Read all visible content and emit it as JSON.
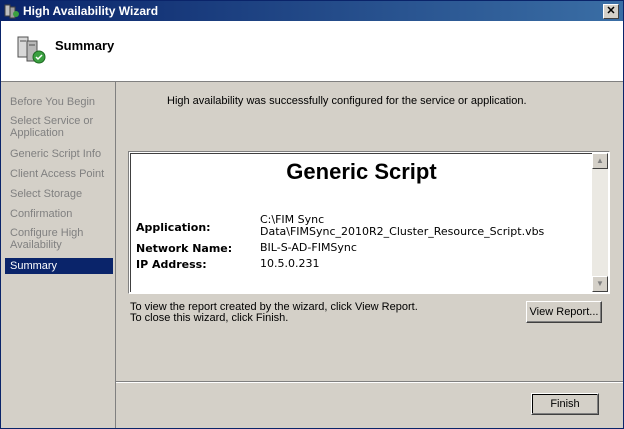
{
  "window": {
    "title": "High Availability Wizard",
    "close_glyph": "✕"
  },
  "header": {
    "title": "Summary"
  },
  "sidebar": {
    "items": [
      {
        "label": "Before You Begin"
      },
      {
        "label": "Select Service or Application"
      },
      {
        "label": "Generic Script Info"
      },
      {
        "label": "Client Access Point"
      },
      {
        "label": "Select Storage"
      },
      {
        "label": "Confirmation"
      },
      {
        "label": "Configure High Availability"
      },
      {
        "label": "Summary"
      }
    ]
  },
  "main": {
    "success_message": "High availability was successfully configured for the service or application.",
    "report": {
      "title": "Generic Script",
      "rows": [
        {
          "label": "Application:",
          "value": "C:\\FIM Sync Data\\FIMSync_2010R2_Cluster_Resource_Script.vbs"
        },
        {
          "label": "Network Name:",
          "value": "BIL-S-AD-FIMSync"
        },
        {
          "label": "IP Address:",
          "value": "10.5.0.231"
        }
      ]
    },
    "info_line1": "To view the report created by the wizard, click View Report.",
    "info_line2": "To close this wizard, click Finish.",
    "view_report_label": "View Report...",
    "finish_label": "Finish"
  },
  "icons": {
    "app": "cluster-wizard-icon",
    "header": "cluster-servers-icon"
  }
}
